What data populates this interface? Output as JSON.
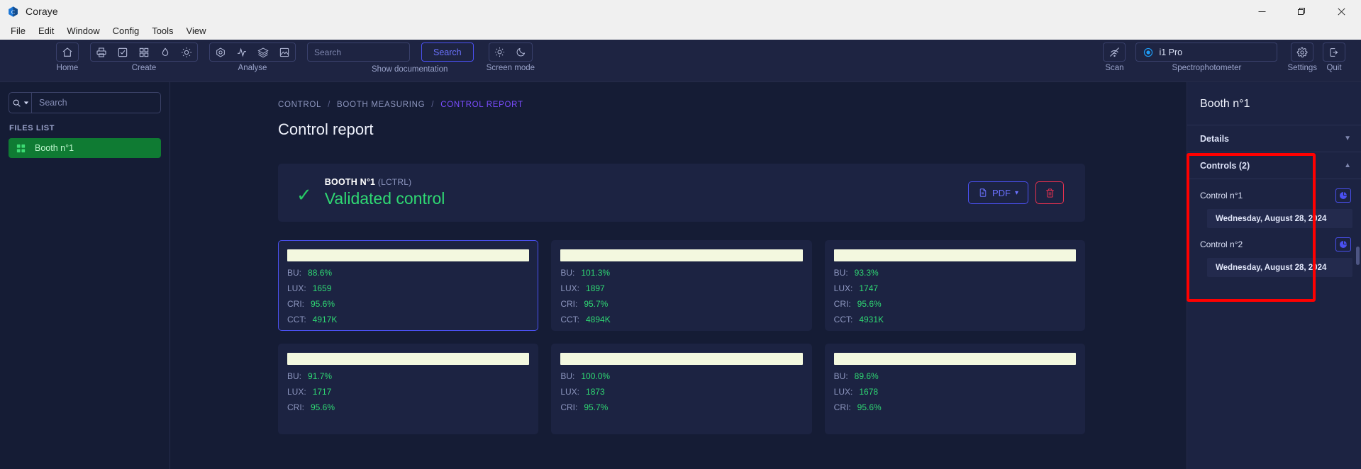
{
  "window": {
    "app_title": "Coraye",
    "controls": {
      "minimize": "—",
      "maximize": "❐",
      "close": "✕"
    }
  },
  "menubar": {
    "items": [
      "File",
      "Edit",
      "Window",
      "Config",
      "Tools",
      "View"
    ]
  },
  "toolbar": {
    "groups": [
      {
        "label": "Home",
        "icons": [
          "home-icon"
        ]
      },
      {
        "label": "Create",
        "icons": [
          "print-icon",
          "checkbox-task-icon",
          "grid-icon",
          "droplet-icon",
          "sun-icon"
        ]
      },
      {
        "label": "Analyse",
        "icons": [
          "gem-icon",
          "pulse-icon",
          "layers-icon",
          "image-icon"
        ]
      }
    ],
    "search_placeholder": "Search",
    "search_value": "",
    "search_button": "Search",
    "documentation_label": "Show documentation",
    "screen_mode_label": "Screen mode",
    "screen_mode_icons": [
      "sun-icon",
      "moon-icon"
    ],
    "scan_label": "Scan",
    "scan_icon": "scan-off-icon",
    "device_label": "Spectrophotometer",
    "device_name": "i1 Pro",
    "device_icon": "radio-selected-icon",
    "settings_label": "Settings",
    "settings_icon": "gear-icon",
    "quit_label": "Quit",
    "quit_icon": "logout-icon"
  },
  "sidebar": {
    "search_placeholder": "Search",
    "search_value": "",
    "search_icon": "search-icon",
    "dropdown_icon": "caret-down-icon",
    "files_list_label": "FILES LIST",
    "files": [
      {
        "label": "Booth n°1",
        "icon": "grid-icon",
        "selected": true
      }
    ]
  },
  "main": {
    "breadcrumb": [
      {
        "label": "CONTROL",
        "active": false
      },
      {
        "label": "BOOTH MEASURING",
        "active": false
      },
      {
        "label": "CONTROL REPORT",
        "active": true
      }
    ],
    "breadcrumb_separator": "/",
    "page_title": "Control report",
    "report": {
      "status_icon": "check-icon",
      "booth_name": "BOOTH N°1",
      "booth_code": "(LCTRL)",
      "status_text": "Validated control",
      "pdf_button": "PDF",
      "pdf_icon": "file-pdf-icon",
      "pdf_caret": "▾",
      "delete_icon": "trash-icon"
    },
    "measure_labels": {
      "bu": "BU:",
      "lux": "LUX:",
      "cri": "CRI:",
      "cct": "CCT:"
    },
    "measurements": [
      {
        "swatch": "#f3f8df",
        "bu": "88.6%",
        "lux": "1659",
        "cri": "95.6%",
        "cct": "4917K",
        "selected": true
      },
      {
        "swatch": "#f3f8df",
        "bu": "101.3%",
        "lux": "1897",
        "cri": "95.7%",
        "cct": "4894K",
        "selected": false
      },
      {
        "swatch": "#f3f8df",
        "bu": "93.3%",
        "lux": "1747",
        "cri": "95.6%",
        "cct": "4931K",
        "selected": false
      },
      {
        "swatch": "#f3f8df",
        "bu": "91.7%",
        "lux": "1717",
        "cri": "95.6%",
        "cct": "",
        "selected": false
      },
      {
        "swatch": "#f3f8df",
        "bu": "100.0%",
        "lux": "1873",
        "cri": "95.7%",
        "cct": "",
        "selected": false
      },
      {
        "swatch": "#f3f8df",
        "bu": "89.6%",
        "lux": "1678",
        "cri": "95.6%",
        "cct": "",
        "selected": false
      }
    ]
  },
  "right_panel": {
    "title": "Booth n°1",
    "details_label": "Details",
    "details_chevron": "▼",
    "controls_label": "Controls (2)",
    "controls_chevron": "▲",
    "controls": [
      {
        "label": "Control n°1",
        "icon": "pie-chart-icon",
        "date": "Wednesday, August 28, 2024"
      },
      {
        "label": "Control n°2",
        "icon": "pie-chart-icon",
        "date": "Wednesday, August 28, 2024"
      }
    ]
  },
  "colors": {
    "accent_blue": "#4a50f0",
    "accent_purple": "#7b4dff",
    "success_green": "#2fd873",
    "danger_red": "#e8314f",
    "annotation_red": "#ff0000",
    "panel_bg": "#1c2342",
    "app_bg": "#151c35"
  }
}
